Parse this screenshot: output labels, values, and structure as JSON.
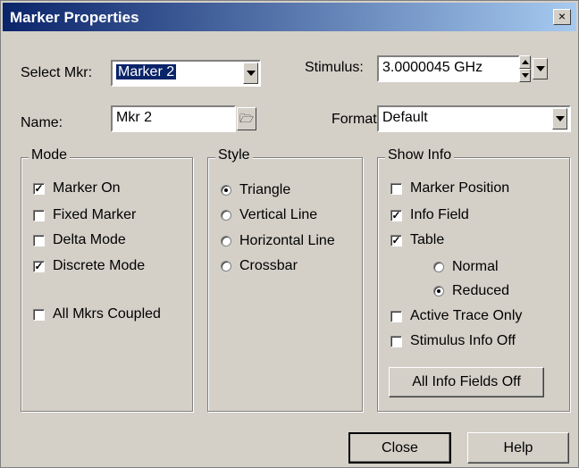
{
  "window": {
    "title": "Marker Properties",
    "close_glyph": "×"
  },
  "select_mkr": {
    "label": "Select Mkr:",
    "value": "Marker 2"
  },
  "stimulus": {
    "label": "Stimulus:",
    "value": "3.0000045 GHz"
  },
  "name": {
    "label": "Name:",
    "value": "Mkr 2",
    "browse_icon": "folder-icon"
  },
  "format": {
    "label": "Format:",
    "value": "Default"
  },
  "mode": {
    "title": "Mode",
    "items": [
      {
        "label": "Marker On",
        "checked": true
      },
      {
        "label": "Fixed Marker",
        "checked": false
      },
      {
        "label": "Delta Mode",
        "checked": false
      },
      {
        "label": "Discrete Mode",
        "checked": true
      },
      {
        "label": "All Mkrs Coupled",
        "checked": false
      }
    ]
  },
  "style": {
    "title": "Style",
    "items": [
      {
        "label": "Triangle",
        "selected": true
      },
      {
        "label": "Vertical Line",
        "selected": false
      },
      {
        "label": "Horizontal Line",
        "selected": false
      },
      {
        "label": "Crossbar",
        "selected": false
      }
    ]
  },
  "show_info": {
    "title": "Show Info",
    "items": [
      {
        "label": "Marker Position",
        "checked": false
      },
      {
        "label": "Info Field",
        "checked": true
      },
      {
        "label": "Table",
        "checked": true
      },
      {
        "label": "Active Trace Only",
        "checked": false
      },
      {
        "label": "Stimulus Info Off",
        "checked": false
      }
    ],
    "table_options": [
      {
        "label": "Normal",
        "selected": false
      },
      {
        "label": "Reduced",
        "selected": true
      }
    ],
    "all_off_label": "All Info Fields Off"
  },
  "buttons": {
    "close": "Close",
    "help": "Help"
  }
}
